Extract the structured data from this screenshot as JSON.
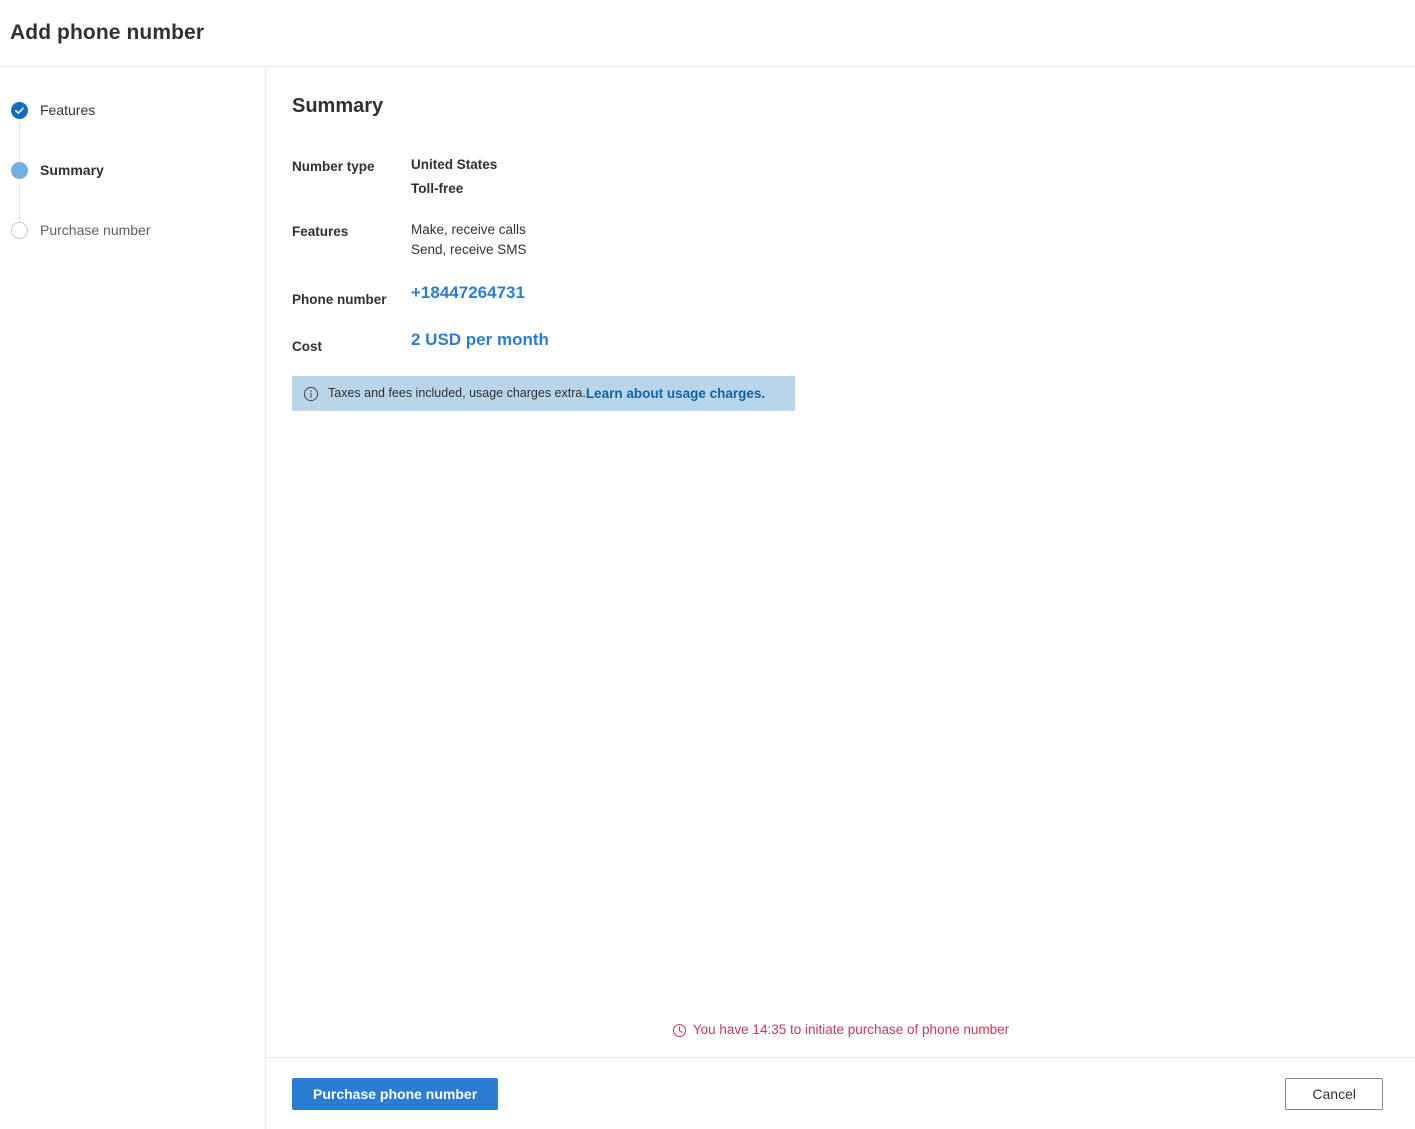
{
  "header": {
    "title": "Add phone number"
  },
  "wizard": {
    "steps": [
      {
        "label": "Features",
        "state": "done",
        "icon": "check-icon"
      },
      {
        "label": "Summary",
        "state": "current",
        "icon": "filled-circle-icon"
      },
      {
        "label": "Purchase number",
        "state": "todo",
        "icon": "empty-circle-icon"
      }
    ]
  },
  "summary": {
    "heading": "Summary",
    "rows": [
      {
        "label": "Number type",
        "values": [
          "United States",
          "Toll-free"
        ],
        "style": "semibold"
      },
      {
        "label": "Features",
        "values": [
          "Make, receive calls",
          "Send, receive SMS"
        ],
        "style": "stacked"
      },
      {
        "label": "Phone number",
        "values": [
          "+18447264731"
        ],
        "style": "accent"
      },
      {
        "label": "Cost",
        "values": [
          "2 USD per month"
        ],
        "style": "accent"
      }
    ],
    "banner": {
      "icon": "info-circle-icon",
      "text": "Taxes and fees included, usage charges extra.",
      "link_label": "Learn about usage charges.",
      "background_color": "#b8d5ea",
      "link_color": "#1264a3"
    }
  },
  "timer": {
    "icon": "clock-icon",
    "text": "You have 14:35 to initiate purchase of phone number",
    "color": "#c23b56"
  },
  "footer": {
    "primary_label": "Purchase phone number",
    "secondary_label": "Cancel",
    "primary_color": "#2b7cd3"
  }
}
